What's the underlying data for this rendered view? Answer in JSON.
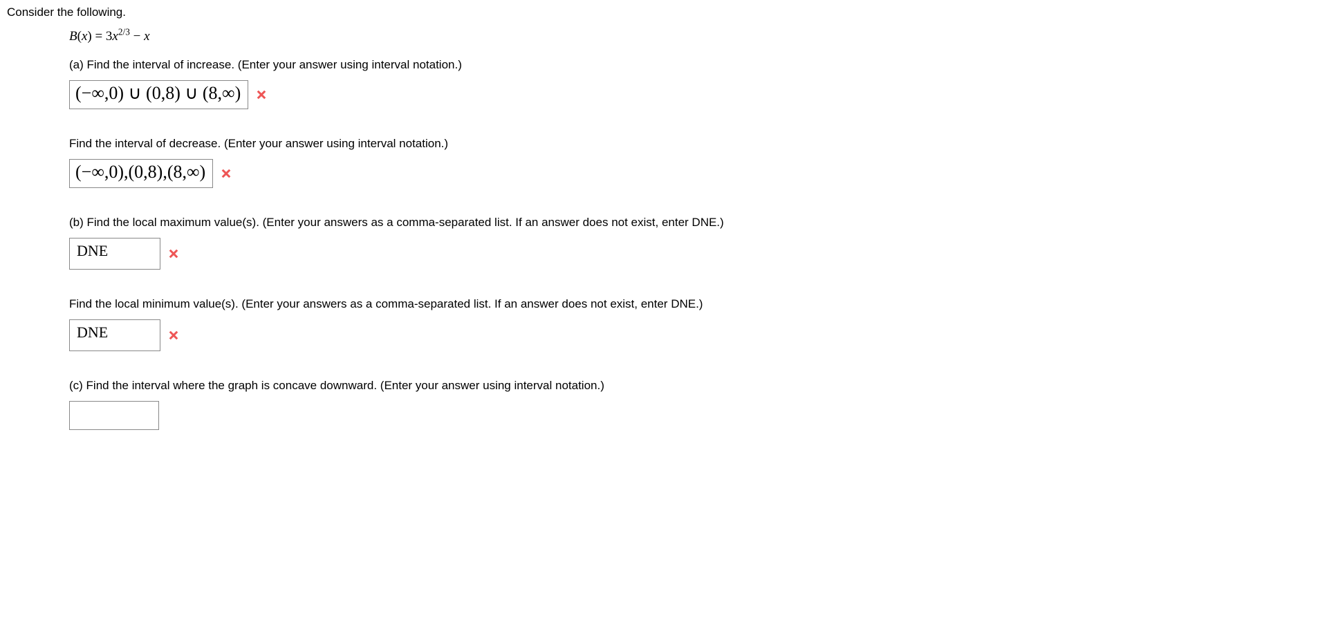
{
  "intro": "Consider the following.",
  "formula_prefix": "B",
  "formula_var": "x",
  "formula_coeff": "3",
  "formula_exp": "2/3",
  "formula_tail": "x",
  "q_a_increase": "(a) Find the interval of increase. (Enter your answer using interval notation.)",
  "ans_a_increase": "(−∞,0) ∪ (0,8) ∪ (8,∞)",
  "q_a_decrease": "Find the interval of decrease. (Enter your answer using interval notation.)",
  "ans_a_decrease": "(−∞,0),(0,8),(8,∞)",
  "q_b_max": "(b) Find the local maximum value(s). (Enter your answers as a comma-separated list. If an answer does not exist, enter DNE.)",
  "ans_b_max": "DNE",
  "q_b_min": "Find the local minimum value(s). (Enter your answers as a comma-separated list. If an answer does not exist, enter DNE.)",
  "ans_b_min": "DNE",
  "q_c": "(c) Find the interval where the graph is concave downward. (Enter your answer using interval notation.)",
  "ans_c": ""
}
